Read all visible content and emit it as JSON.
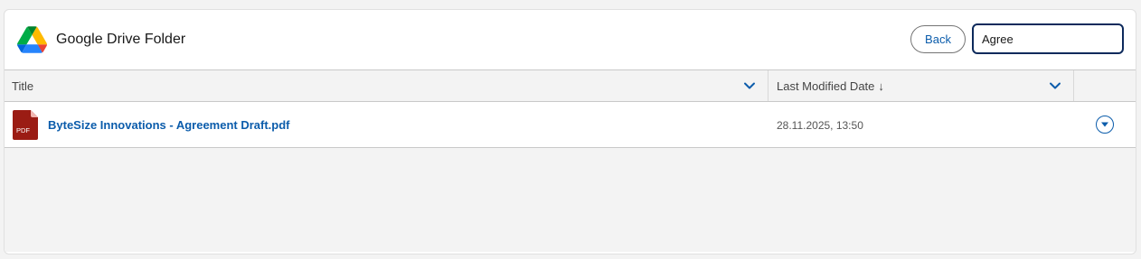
{
  "header": {
    "title": "Google Drive Folder",
    "logo_icon": "google-drive-icon",
    "back_label": "Back",
    "search_value": "Agree"
  },
  "table": {
    "columns": [
      {
        "label": "Title",
        "sort_icon": null
      },
      {
        "label": "Last Modified Date",
        "sort_icon": "↓"
      }
    ],
    "rows": [
      {
        "icon": "pdf-icon",
        "icon_text": "PDF",
        "title": "ByteSize Innovations - Agreement Draft.pdf",
        "modified": "28.11.2025, 13:50"
      }
    ]
  },
  "colors": {
    "accent": "#0b5cab",
    "pdf_red": "#9b1c14",
    "search_border": "#0d2a5c"
  }
}
